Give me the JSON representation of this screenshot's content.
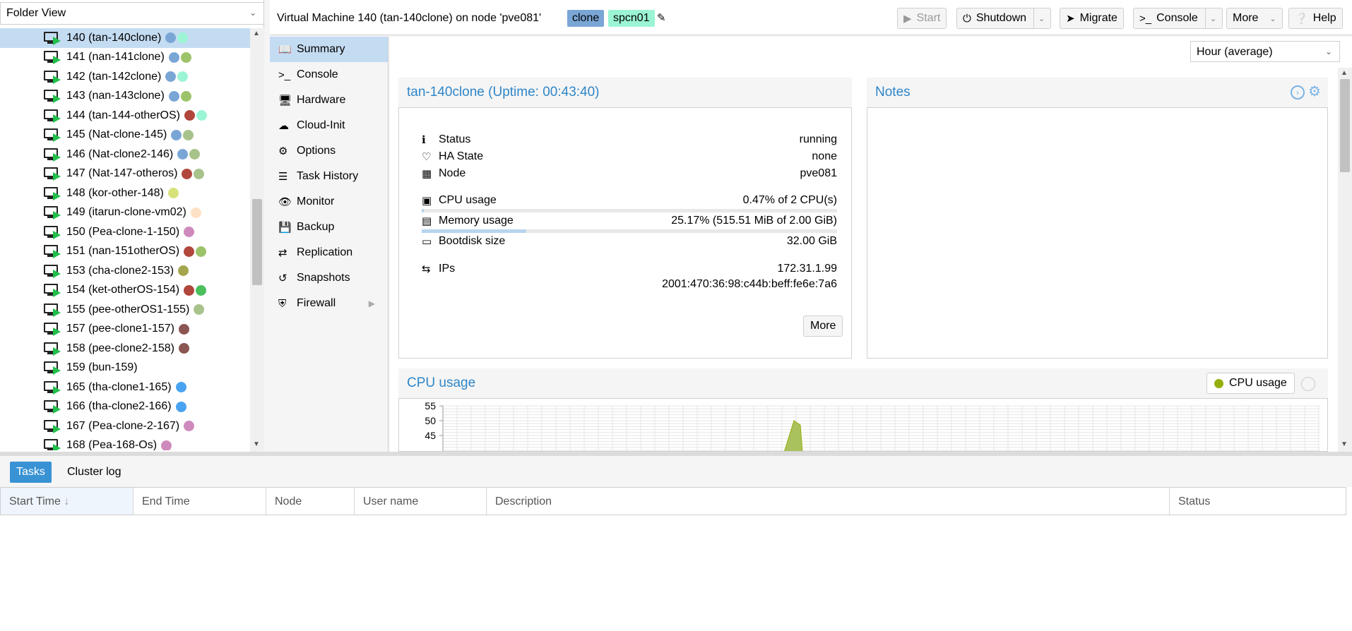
{
  "tree": {
    "view_selector": "Folder View",
    "items": [
      {
        "label": "140 (tan-140clone)",
        "tags": [
          "#7aa6d6",
          "#9bf5d4"
        ],
        "selected": true
      },
      {
        "label": "141 (nan-141clone)",
        "tags": [
          "#7aa6d6",
          "#9cc36a"
        ]
      },
      {
        "label": "142 (tan-142clone)",
        "tags": [
          "#7aa6d6",
          "#9bf5d4"
        ]
      },
      {
        "label": "143 (nan-143clone)",
        "tags": [
          "#7aa6d6",
          "#9cc36a"
        ]
      },
      {
        "label": "144 (tan-144-otherOS)",
        "tags": [
          "#b0463c",
          "#9bf5d4"
        ]
      },
      {
        "label": "145 (Nat-clone-145)",
        "tags": [
          "#7aa6d6",
          "#a8c28c"
        ]
      },
      {
        "label": "146 (Nat-clone2-146)",
        "tags": [
          "#7aa6d6",
          "#a8c28c"
        ]
      },
      {
        "label": "147 (Nat-147-otheros)",
        "tags": [
          "#b0463c",
          "#a8c28c"
        ]
      },
      {
        "label": "148 (kor-other-148)",
        "tags": [
          "#d8e27a"
        ]
      },
      {
        "label": "149 (itarun-clone-vm02)",
        "tags": [
          "#fde1c6"
        ]
      },
      {
        "label": "150 (Pea-clone-1-150)",
        "tags": [
          "#cf8abd"
        ]
      },
      {
        "label": "151 (nan-151otherOS)",
        "tags": [
          "#b0463c",
          "#9cc36a"
        ]
      },
      {
        "label": "153 (cha-clone2-153)",
        "tags": [
          "#a4a64e"
        ]
      },
      {
        "label": "154 (ket-otherOS-154)",
        "tags": [
          "#b0463c",
          "#4bbf5c"
        ]
      },
      {
        "label": "155 (pee-otherOS1-155)",
        "tags": [
          "#a8c28c"
        ]
      },
      {
        "label": "157 (pee-clone1-157)",
        "tags": [
          "#8b5552"
        ]
      },
      {
        "label": "158 (pee-clone2-158)",
        "tags": [
          "#8b5552"
        ]
      },
      {
        "label": "159 (bun-159)",
        "tags": []
      },
      {
        "label": "165 (tha-clone1-165)",
        "tags": [
          "#4aa3f0"
        ]
      },
      {
        "label": "166 (tha-clone2-166)",
        "tags": [
          "#4aa3f0"
        ]
      },
      {
        "label": "167 (Pea-clone-2-167)",
        "tags": [
          "#cf8abd"
        ]
      },
      {
        "label": "168 (Pea-168-Os)",
        "tags": [
          "#cf8abd"
        ]
      }
    ]
  },
  "header": {
    "title": "Virtual Machine 140 (tan-140clone) on node 'pve081'",
    "tags": [
      "clone",
      "spcn01"
    ],
    "buttons": {
      "start": "Start",
      "shutdown": "Shutdown",
      "migrate": "Migrate",
      "console": "Console",
      "more": "More",
      "help": "Help"
    }
  },
  "nav": [
    {
      "label": "Summary",
      "icon": "book-icon",
      "glyph": "📖",
      "active": true
    },
    {
      "label": "Console",
      "icon": "terminal-icon",
      "glyph": ">_"
    },
    {
      "label": "Hardware",
      "icon": "desktop-icon",
      "glyph": "🖥"
    },
    {
      "label": "Cloud-Init",
      "icon": "cloud-icon",
      "glyph": "☁"
    },
    {
      "label": "Options",
      "icon": "gear-icon",
      "glyph": "⚙"
    },
    {
      "label": "Task History",
      "icon": "list-icon",
      "glyph": "☰"
    },
    {
      "label": "Monitor",
      "icon": "eye-icon",
      "glyph": "👁"
    },
    {
      "label": "Backup",
      "icon": "floppy-icon",
      "glyph": "💾"
    },
    {
      "label": "Replication",
      "icon": "retweet-icon",
      "glyph": "⇄"
    },
    {
      "label": "Snapshots",
      "icon": "history-icon",
      "glyph": "↺"
    },
    {
      "label": "Firewall",
      "icon": "shield-icon",
      "glyph": "⛨",
      "has_submenu": true
    }
  ],
  "main": {
    "timeframe": "Hour (average)",
    "status_panel": {
      "title": "tan-140clone (Uptime: 00:43:40)",
      "rows": {
        "status": {
          "label": "Status",
          "value": "running"
        },
        "ha": {
          "label": "HA State",
          "value": "none"
        },
        "node": {
          "label": "Node",
          "value": "pve081"
        },
        "cpu": {
          "label": "CPU usage",
          "value": "0.47% of 2 CPU(s)",
          "fraction": 0.0047
        },
        "memory": {
          "label": "Memory usage",
          "value": "25.17% (515.51 MiB of 2.00 GiB)",
          "fraction": 0.2517
        },
        "bootdisk": {
          "label": "Bootdisk size",
          "value": "32.00 GiB"
        },
        "ips": {
          "label": "IPs",
          "value1": "172.31.1.99",
          "value2": "2001:470:36:98:c44b:beff:fe6e:7a6"
        }
      },
      "more_button": "More"
    },
    "notes_panel": {
      "title": "Notes"
    },
    "cpu_chart_panel": {
      "title": "CPU usage",
      "legend": "CPU usage"
    }
  },
  "chart_data": {
    "type": "area",
    "series": [
      {
        "name": "CPU usage",
        "color": "#94ae0a"
      }
    ],
    "y_ticks": [
      "55",
      "50",
      "45"
    ],
    "ylim": [
      40,
      55
    ],
    "visible_peak": {
      "y": 50
    }
  },
  "bottom": {
    "tabs": [
      "Tasks",
      "Cluster log"
    ],
    "columns": [
      "Start Time",
      "End Time",
      "Node",
      "User name",
      "Description",
      "Status"
    ]
  }
}
